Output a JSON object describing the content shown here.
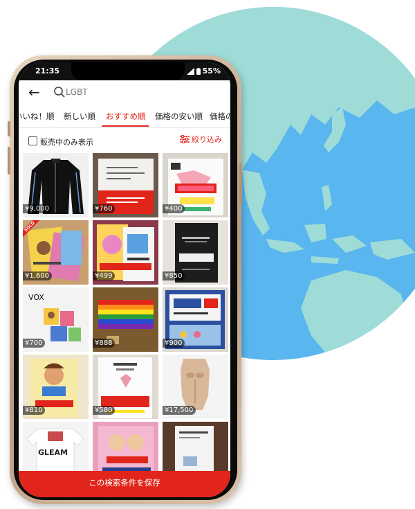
{
  "status_bar": {
    "time": "21:35",
    "battery": "55%"
  },
  "search": {
    "query": "LGBT"
  },
  "sort_tabs": [
    {
      "label": "いいね！順",
      "active": false
    },
    {
      "label": "新しい順",
      "active": false
    },
    {
      "label": "おすすめ順",
      "active": true
    },
    {
      "label": "価格の安い順",
      "active": false
    },
    {
      "label": "価格の",
      "active": false
    }
  ],
  "filter": {
    "checkbox_label": "販売中のみ表示",
    "checked": false,
    "filter_label": "絞り込み"
  },
  "items": [
    {
      "price": "¥9,000",
      "image": "black-track-jacket",
      "sold": false
    },
    {
      "price": "¥760",
      "image": "red-white-book",
      "sold": false
    },
    {
      "price": "¥400",
      "image": "manga-lgbt-book",
      "sold": false
    },
    {
      "price": "¥1,600",
      "image": "books-stack",
      "sold": true,
      "sold_text": "SOLD"
    },
    {
      "price": "¥499",
      "image": "colorful-magazines",
      "sold": false
    },
    {
      "price": "¥850",
      "image": "coming-out-book",
      "sold": false
    },
    {
      "price": "¥700",
      "image": "vox-tshirt",
      "sold": false,
      "caption": "VOX"
    },
    {
      "price": "¥888",
      "image": "rainbow-flag",
      "sold": false
    },
    {
      "price": "¥900",
      "image": "lgbt-sogi-book",
      "sold": false
    },
    {
      "price": "¥810",
      "image": "comic-book",
      "sold": false
    },
    {
      "price": "¥580",
      "image": "lgbt-wedding-book",
      "sold": false
    },
    {
      "price": "¥17,500",
      "image": "torso-figure",
      "sold": false
    },
    {
      "price": "",
      "image": "gleam-tshirt",
      "sold": false,
      "caption": "GLEAM"
    },
    {
      "price": "",
      "image": "pink-manga-book",
      "sold": false
    },
    {
      "price": "",
      "image": "gender-book",
      "sold": false
    }
  ],
  "save_button": {
    "label": "この検索条件を保存"
  },
  "colors": {
    "accent": "#e1251b",
    "ocean": "#5ab6ee",
    "land": "#9fdcd8"
  }
}
